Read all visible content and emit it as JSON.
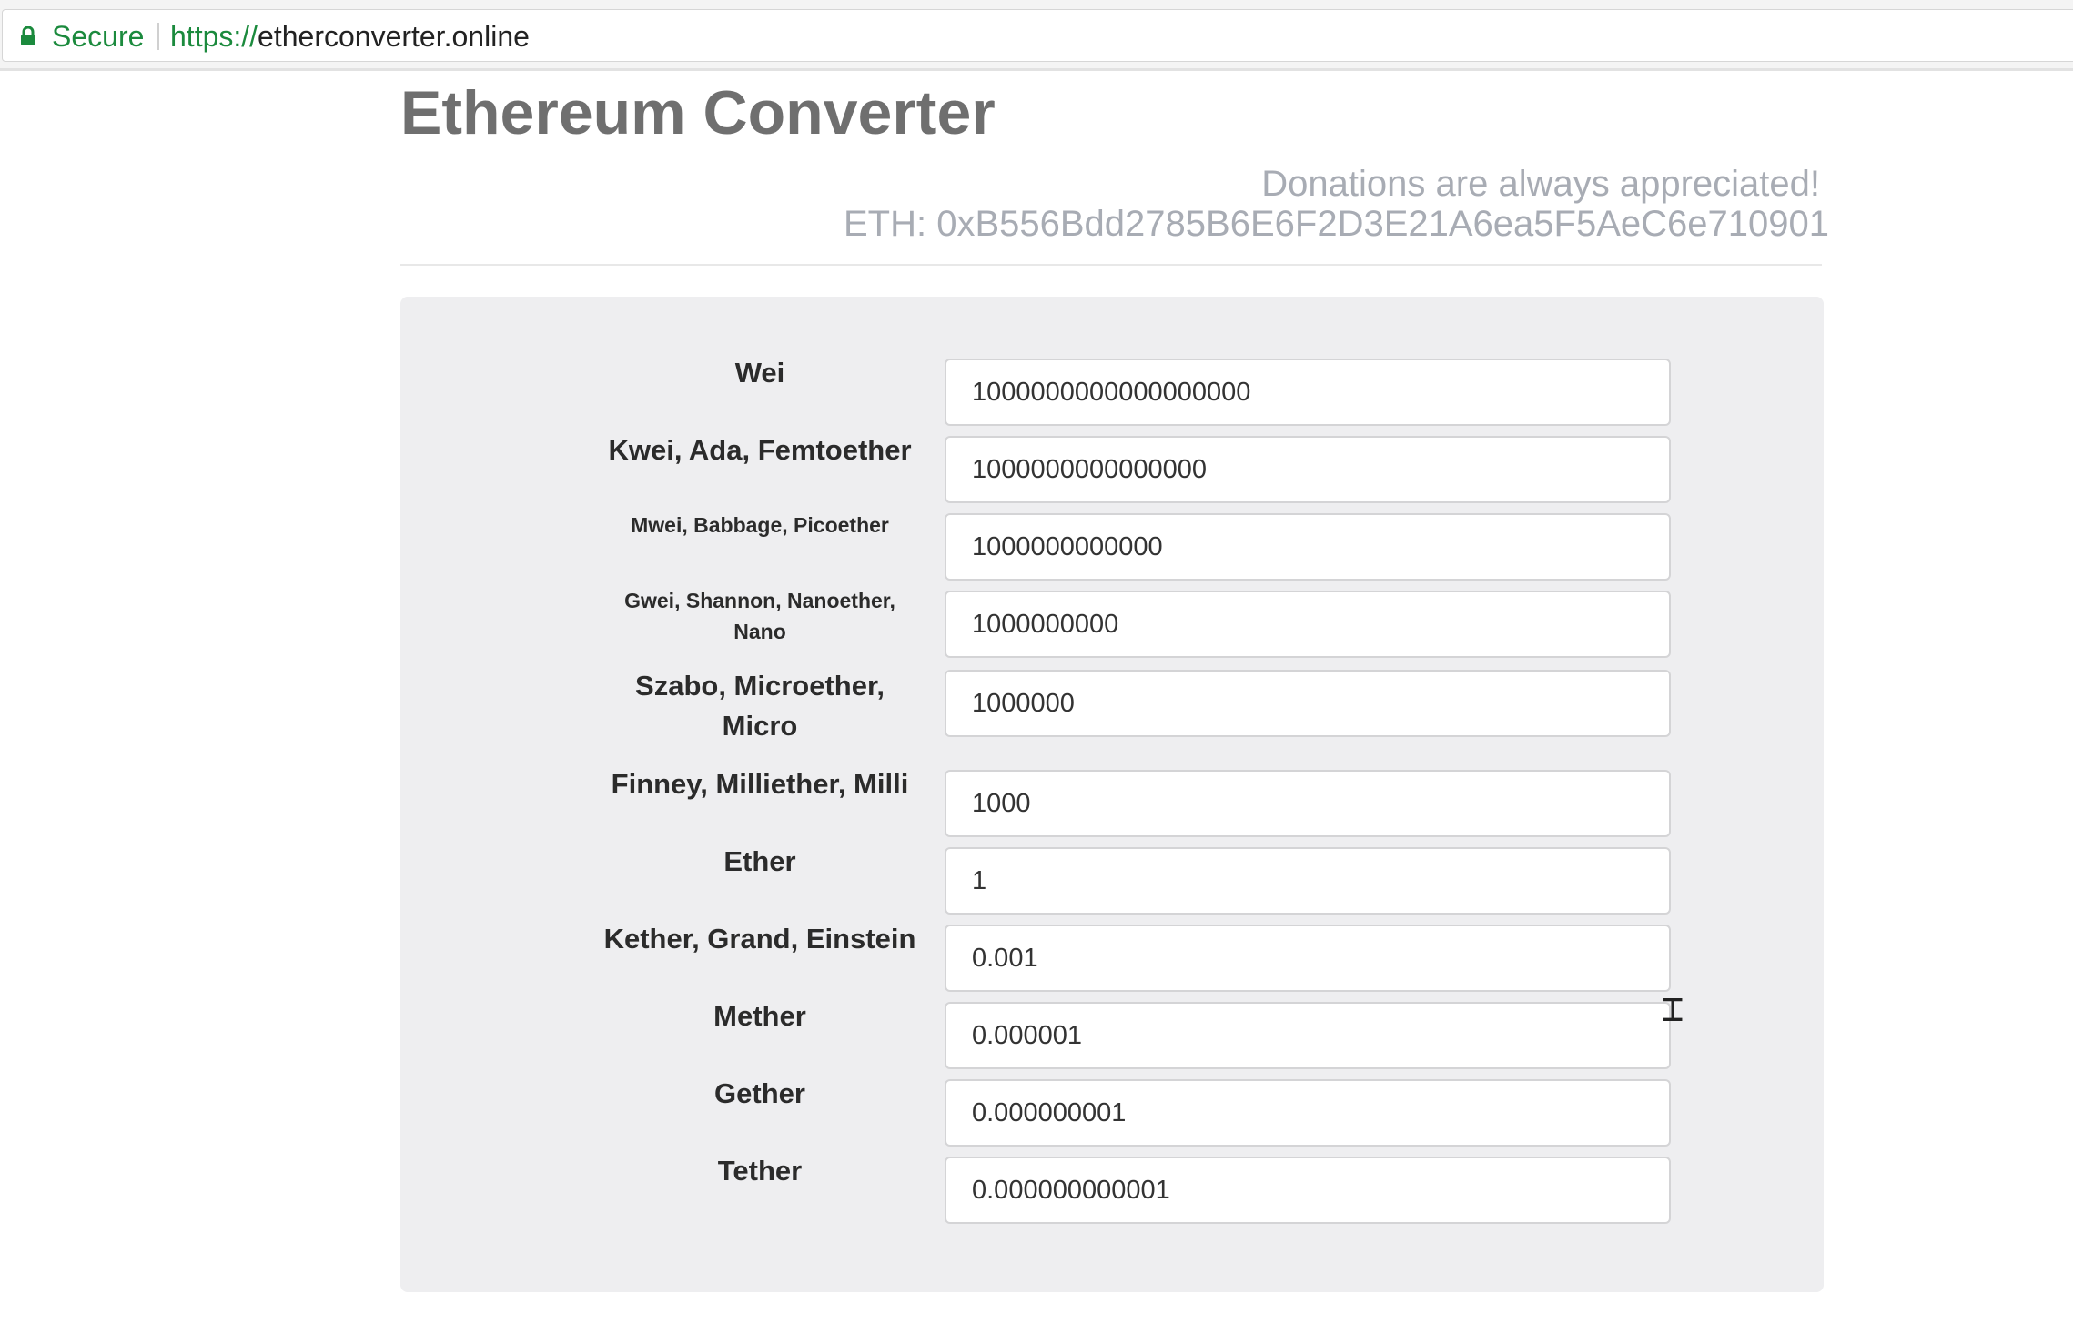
{
  "browser": {
    "secure_label": "Secure",
    "url_scheme": "https://",
    "url_host": "etherconverter.online"
  },
  "page": {
    "title": "Ethereum Converter",
    "donation_text": "Donations are always appreciated!",
    "donation_address": "ETH: 0xB556Bdd2785B6E6F2D3E21A6ea5F5AeC6e710901"
  },
  "units": [
    {
      "label": "Wei",
      "value": "1000000000000000000"
    },
    {
      "label": "Kwei, Ada, Femtoether",
      "value": "1000000000000000"
    },
    {
      "label": "Mwei, Babbage, Picoether",
      "value": "1000000000000"
    },
    {
      "label": "Gwei, Shannon, Nanoether, Nano",
      "value": "1000000000"
    },
    {
      "label": "Szabo, Microether, Micro",
      "value": "1000000"
    },
    {
      "label": "Finney, Milliether, Milli",
      "value": "1000"
    },
    {
      "label": "Ether",
      "value": "1"
    },
    {
      "label": "Kether, Grand, Einstein",
      "value": "0.001"
    },
    {
      "label": "Mether",
      "value": "0.000001"
    },
    {
      "label": "Gether",
      "value": "0.000000001"
    },
    {
      "label": "Tether",
      "value": "0.000000000001"
    }
  ],
  "colors": {
    "secure_green": "#1b8a3d",
    "title_gray": "#6f6f6f",
    "donation_gray": "#a8acb4",
    "panel_bg": "#eeeef0"
  },
  "icons": [
    "lock-icon",
    "text-cursor-icon"
  ]
}
